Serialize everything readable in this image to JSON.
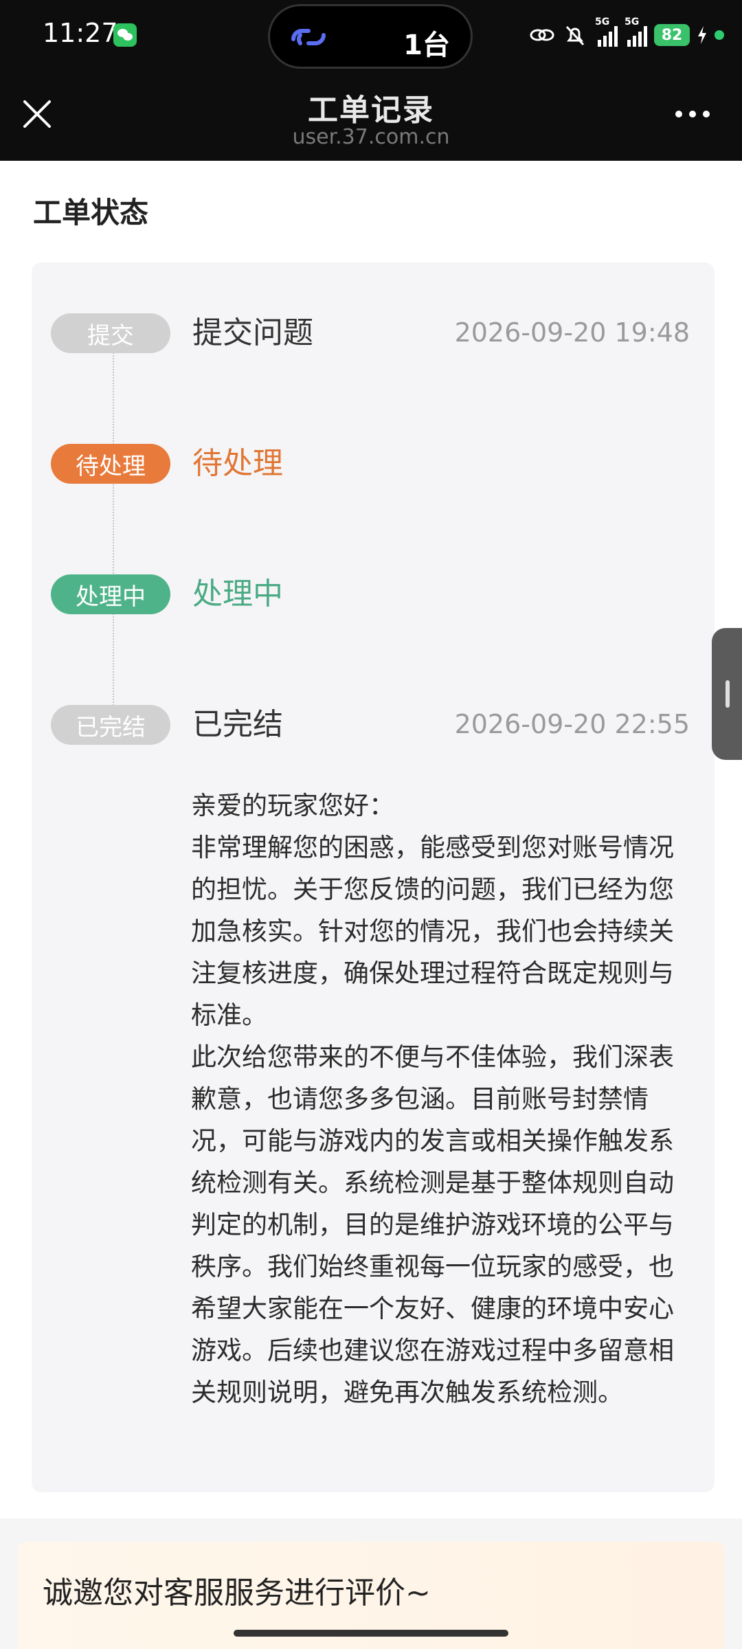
{
  "status_bar": {
    "time": "11:27",
    "island_count": "1台",
    "signal1_tag": "5G",
    "signal2_tag": "5G",
    "battery": "82",
    "icons": [
      "wechat-icon",
      "link-icon",
      "mute-bell-icon",
      "signal-icon",
      "battery-icon",
      "charging-icon"
    ]
  },
  "nav": {
    "title": "工单记录",
    "url": "user.37.com.cn",
    "icons": [
      "close-icon",
      "more-icon"
    ]
  },
  "section": {
    "title": "工单状态"
  },
  "timeline": [
    {
      "badge": "提交",
      "title": "提交问题",
      "time": "2026-09-20 19:48",
      "color": "#d1d1d1"
    },
    {
      "badge": "待处理",
      "title": "待处理",
      "time": "",
      "color": "#e87a3b"
    },
    {
      "badge": "处理中",
      "title": "处理中",
      "time": "",
      "color": "#4fb38a"
    },
    {
      "badge": "已完结",
      "title": "已完结",
      "time": "2026-09-20 22:55",
      "color": "#d1d1d1"
    }
  ],
  "reply": {
    "greeting": "亲爱的玩家您好：",
    "para1": "非常理解您的困惑，能感受到您对账号情况的担忧。关于您反馈的问题，我们已经为您加急核实。针对您的情况，我们也会持续关注复核进度，确保处理过程符合既定规则与标准。",
    "para2": "此次给您带来的不便与不佳体验，我们深表歉意，也请您多多包涵。目前账号封禁情况，可能与游戏内的发言或相关操作触发系统检测有关。系统检测是基于整体规则自动判定的机制，目的是维护游戏环境的公平与秩序。我们始终重视每一位玩家的感受，也希望大家能在一个友好、健康的环境中安心游戏。后续也建议您在游戏过程中多留意相关规则说明，避免再次触发系统检测。"
  },
  "feedback": {
    "text": "诚邀您对客服服务进行评价~"
  }
}
